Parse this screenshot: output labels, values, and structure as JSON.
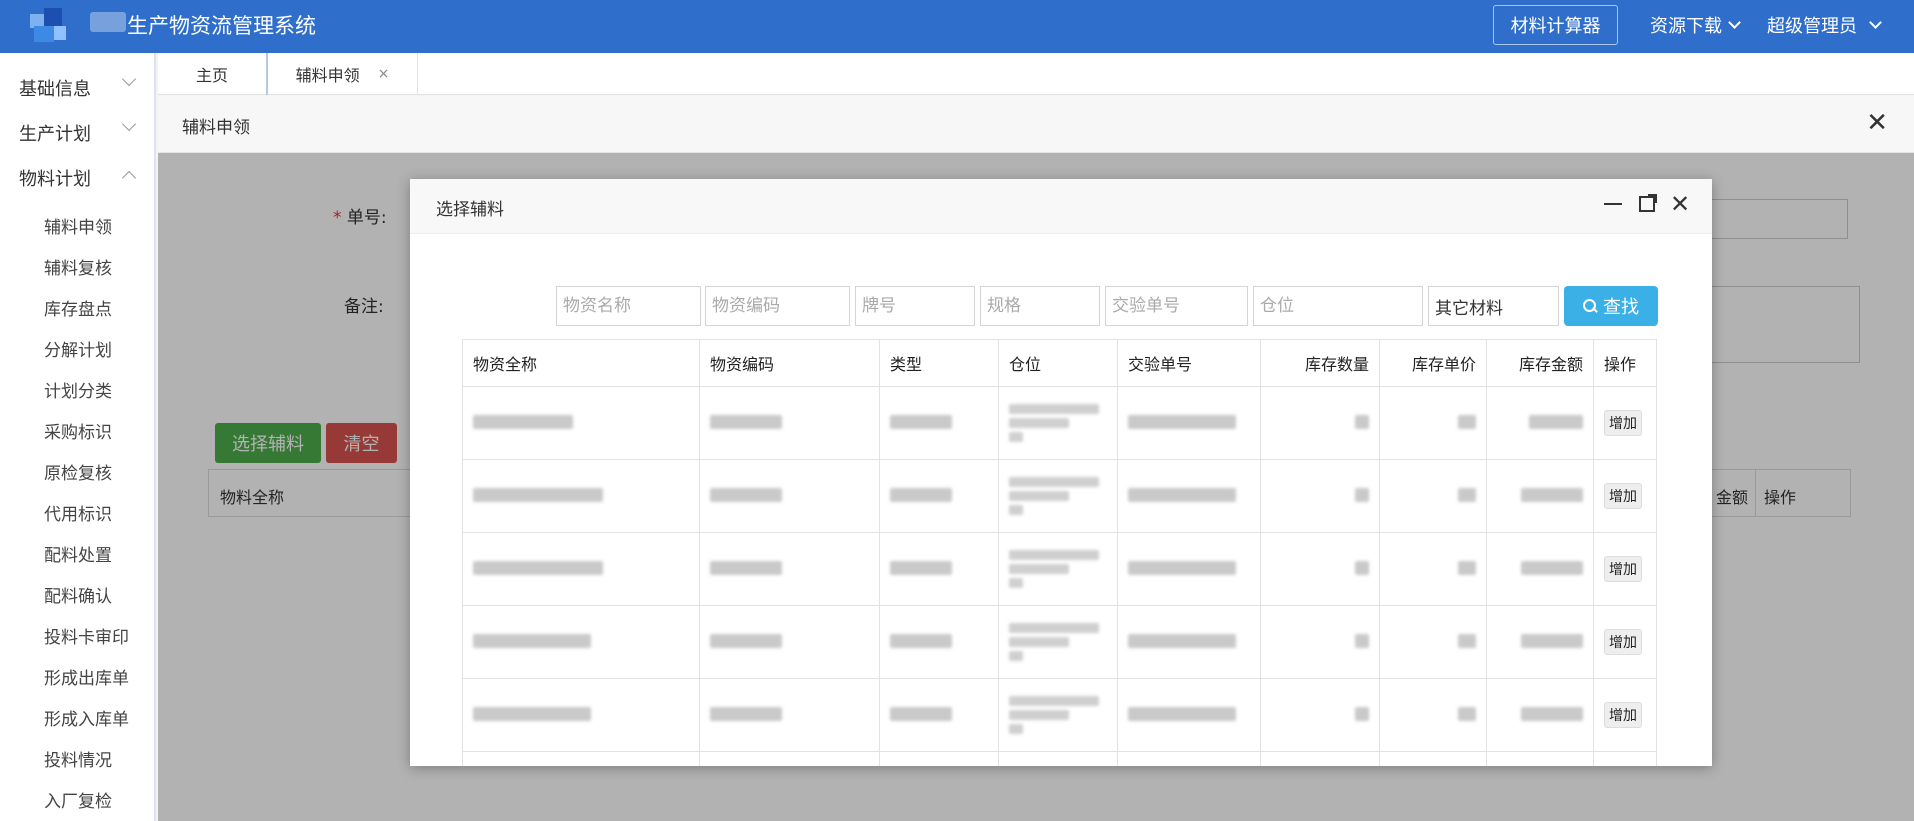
{
  "header": {
    "app_title": "生产物资流管理系统",
    "calc_button": "材料计算器",
    "resources_menu": "资源下载",
    "user_menu": "超级管理员"
  },
  "sidebar": {
    "groups": [
      {
        "label": "基础信息",
        "expanded": false
      },
      {
        "label": "生产计划",
        "expanded": false
      },
      {
        "label": "物料计划",
        "expanded": true
      }
    ],
    "items": [
      "辅料申领",
      "辅料复核",
      "库存盘点",
      "分解计划",
      "计划分类",
      "采购标识",
      "原检复核",
      "代用标识",
      "配料处置",
      "配料确认",
      "投料卡审印",
      "形成出库单",
      "形成入库单",
      "投料情况",
      "入厂复检"
    ]
  },
  "tabs": [
    {
      "label": "主页"
    },
    {
      "label": "辅料申领",
      "close": "×"
    }
  ],
  "panel": {
    "title": "辅料申领",
    "close": "✕",
    "form": {
      "required_mark": "*",
      "order_no_label": "单号:",
      "remark_label": "备注:"
    },
    "buttons": {
      "select": "选择辅料",
      "clear": "清空"
    },
    "table_headers": {
      "first": "物料全称",
      "amount": "金额",
      "action": "操作"
    }
  },
  "dialog": {
    "title": "选择辅料",
    "search": {
      "placeholders": [
        "物资名称",
        "物资编码",
        "牌号",
        "规格",
        "交验单号",
        "仓位"
      ],
      "category_value": "其它材料",
      "search_button": "查找"
    },
    "columns": [
      "物资全称",
      "物资编码",
      "类型",
      "仓位",
      "交验单号",
      "库存数量",
      "库存单价",
      "库存金额",
      "操作"
    ],
    "row_action": "增加",
    "row_count": 5
  },
  "colors": {
    "header_bg": "#2f6fcb",
    "search_button": "#3ab0e7",
    "select_button": "#4cae4c",
    "clear_button": "#d9534f"
  },
  "icons": [
    "logo",
    "chevron-down-icon",
    "chevron-up-icon",
    "close-icon",
    "minimize-icon",
    "maximize-icon",
    "search-icon"
  ]
}
